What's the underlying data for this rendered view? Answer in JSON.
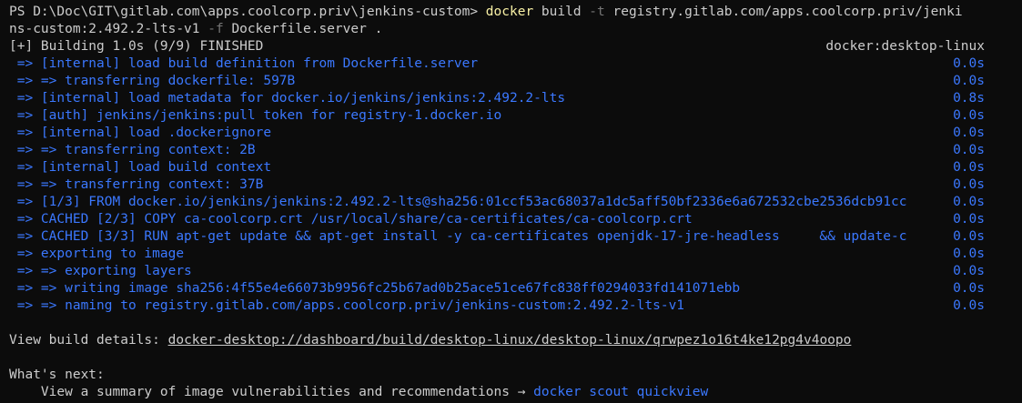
{
  "prompt": {
    "ps_path": "PS D:\\Doc\\GIT\\gitlab.com\\apps.coolcorp.priv\\jenkins-custom> ",
    "cmd": "docker",
    "args1": " build ",
    "flag_t": "-t",
    "tag_part1": " registry.gitlab.com/apps.coolcorp.priv/jenki",
    "tag_part2": "ns-custom:2.492.2-lts-v1 ",
    "flag_f": "-f",
    "file": " Dockerfile.server ."
  },
  "status": {
    "summary": "[+] Building 1.0s (9/9) FINISHED",
    "context": "docker:desktop-linux"
  },
  "steps": [
    {
      "text": " => [internal] load build definition from Dockerfile.server",
      "time": "0.0s"
    },
    {
      "text": " => => transferring dockerfile: 597B",
      "time": "0.0s"
    },
    {
      "text": " => [internal] load metadata for docker.io/jenkins/jenkins:2.492.2-lts",
      "time": "0.8s"
    },
    {
      "text": " => [auth] jenkins/jenkins:pull token for registry-1.docker.io",
      "time": "0.0s"
    },
    {
      "text": " => [internal] load .dockerignore",
      "time": "0.0s"
    },
    {
      "text": " => => transferring context: 2B",
      "time": "0.0s"
    },
    {
      "text": " => [internal] load build context",
      "time": "0.0s"
    },
    {
      "text": " => => transferring context: 37B",
      "time": "0.0s"
    },
    {
      "text": " => [1/3] FROM docker.io/jenkins/jenkins:2.492.2-lts@sha256:01ccf53ac68037a1dc5aff50bf2336e6a672532cbe2536dcb91cc",
      "time": "0.0s"
    },
    {
      "text": " => CACHED [2/3] COPY ca-coolcorp.crt /usr/local/share/ca-certificates/ca-coolcorp.crt",
      "time": "0.0s"
    },
    {
      "text": " => CACHED [3/3] RUN apt-get update && apt-get install -y ca-certificates openjdk-17-jre-headless     && update-c",
      "time": "0.0s"
    },
    {
      "text": " => exporting to image",
      "time": "0.0s"
    },
    {
      "text": " => => exporting layers",
      "time": "0.0s"
    },
    {
      "text": " => => writing image sha256:4f55e4e66073b9956fc25b67ad0b25ace51ce67fc838ff0294033fd141071ebb",
      "time": "0.0s"
    },
    {
      "text": " => => naming to registry.gitlab.com/apps.coolcorp.priv/jenkins-custom:2.492.2-lts-v1",
      "time": "0.0s"
    }
  ],
  "details": {
    "label": "View build details: ",
    "url": "docker-desktop://dashboard/build/desktop-linux/desktop-linux/qrwpez1o16t4ke12pg4v4oopo"
  },
  "next": {
    "heading": "What's next:",
    "item_text": "    View a summary of image vulnerabilities and recommendations → ",
    "item_cmd": "docker scout quickview"
  }
}
